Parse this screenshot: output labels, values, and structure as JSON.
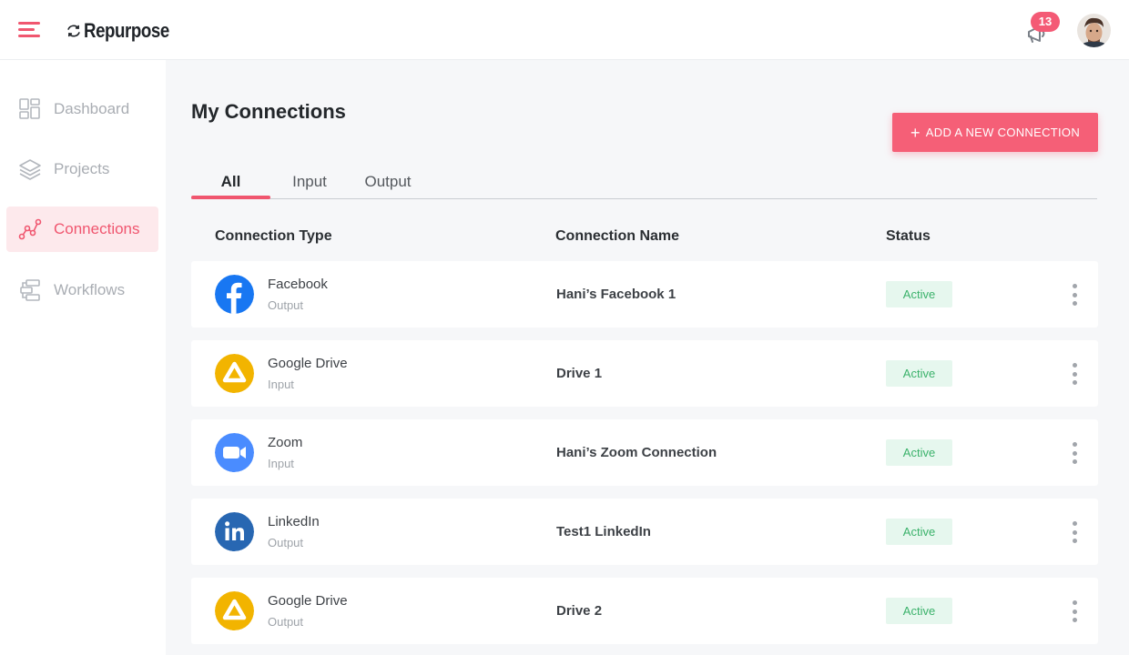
{
  "app": {
    "brand": "Repurpose",
    "notifications_count": "13"
  },
  "sidebar": {
    "items": [
      {
        "label": "Dashboard",
        "icon": "dashboard-icon",
        "active": false
      },
      {
        "label": "Projects",
        "icon": "layers-icon",
        "active": false
      },
      {
        "label": "Connections",
        "icon": "connections-icon",
        "active": true
      },
      {
        "label": "Workflows",
        "icon": "workflows-icon",
        "active": false
      }
    ]
  },
  "main": {
    "title": "My Connections",
    "add_button_label": "ADD A NEW CONNECTION",
    "tabs": [
      {
        "label": "All",
        "active": true
      },
      {
        "label": "Input",
        "active": false
      },
      {
        "label": "Output",
        "active": false
      }
    ],
    "columns": {
      "type": "Connection Type",
      "name": "Connection Name",
      "status": "Status"
    },
    "rows": [
      {
        "service": "Facebook",
        "kind": "Output",
        "name": "Hani’s Facebook 1",
        "status": "Active",
        "icon": "facebook-icon"
      },
      {
        "service": "Google Drive",
        "kind": "Input",
        "name": "Drive 1",
        "status": "Active",
        "icon": "google-drive-icon"
      },
      {
        "service": "Zoom",
        "kind": "Input",
        "name": "Hani’s Zoom Connection",
        "status": "Active",
        "icon": "zoom-icon"
      },
      {
        "service": "LinkedIn",
        "kind": "Output",
        "name": "Test1 LinkedIn",
        "status": "Active",
        "icon": "linkedin-icon"
      },
      {
        "service": "Google Drive",
        "kind": "Output",
        "name": "Drive 2",
        "status": "Active",
        "icon": "google-drive-icon"
      }
    ]
  },
  "colors": {
    "accent": "#f0566f",
    "button": "#f55f77",
    "status_bg": "#e6f7ee",
    "status_text": "#3bb26b",
    "facebook": "#1877f2",
    "google_drive": "#f2b400",
    "zoom": "#4a8cff",
    "linkedin": "#2867b2"
  }
}
